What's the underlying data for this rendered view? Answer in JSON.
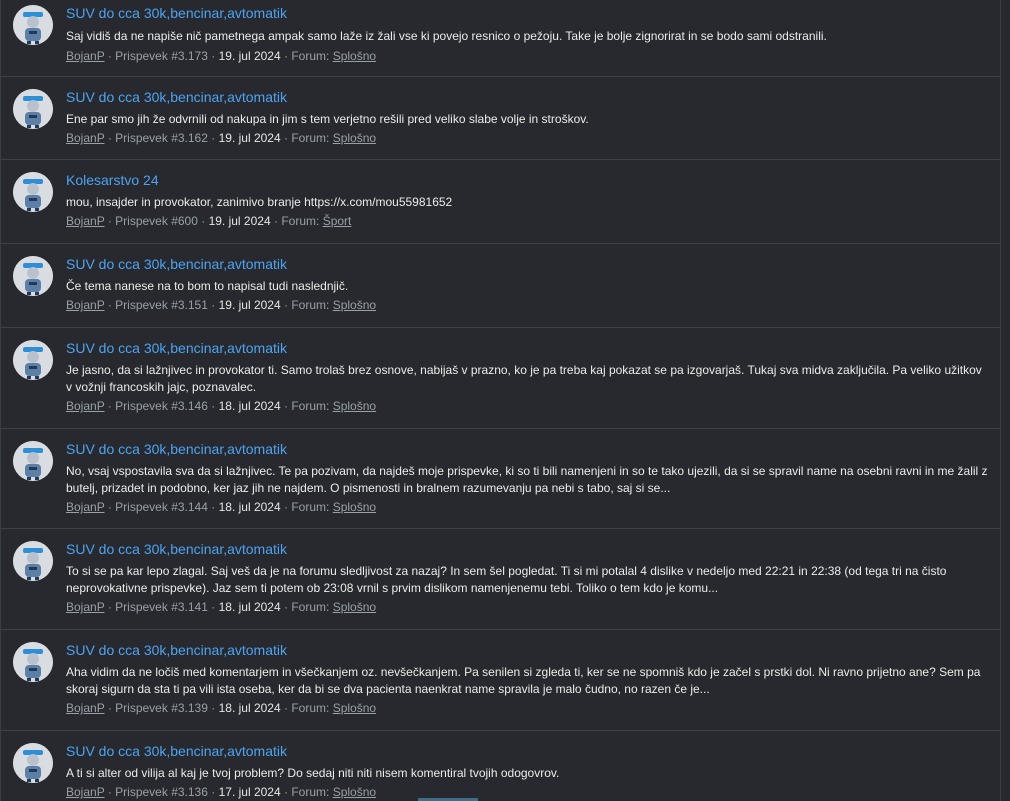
{
  "posts": [
    {
      "thread_title": "SUV do cca 30k,bencinar,avtomatik",
      "snippet": "Saj vidiš da ne napiše nič pametnega ampak samo laže iz žali vse ki povejo resnico o pežoju. Take je bolje zignorirat in se bodo sami odstranili.",
      "author": "BojanP",
      "sep1": "·",
      "post_number": "Prispevek #3.173",
      "sep2": "·",
      "date": "19. jul 2024",
      "sep3": "·",
      "forum_prefix": "Forum:",
      "forum": "Splošno"
    },
    {
      "thread_title": "SUV do cca 30k,bencinar,avtomatik",
      "snippet": "Ene par smo jih že odvrnili od nakupa in jim s tem verjetno rešili pred veliko slabe volje in stroškov.",
      "author": "BojanP",
      "sep1": "·",
      "post_number": "Prispevek #3.162",
      "sep2": "·",
      "date": "19. jul 2024",
      "sep3": "·",
      "forum_prefix": "Forum:",
      "forum": "Splošno"
    },
    {
      "thread_title": "Kolesarstvo 24",
      "snippet": "mou, insajder in provokator, zanimivo branje https://x.com/mou55981652",
      "author": "BojanP",
      "sep1": "·",
      "post_number": "Prispevek #600",
      "sep2": "·",
      "date": "19. jul 2024",
      "sep3": "·",
      "forum_prefix": "Forum:",
      "forum": "Šport"
    },
    {
      "thread_title": "SUV do cca 30k,bencinar,avtomatik",
      "snippet": "Če tema nanese na to bom to napisal tudi naslednjič.",
      "author": "BojanP",
      "sep1": "·",
      "post_number": "Prispevek #3.151",
      "sep2": "·",
      "date": "19. jul 2024",
      "sep3": "·",
      "forum_prefix": "Forum:",
      "forum": "Splošno"
    },
    {
      "thread_title": "SUV do cca 30k,bencinar,avtomatik",
      "snippet": "Je jasno, da si lažnjivec in provokator ti. Samo trolaš brez osnove, nabijaš v prazno, ko je pa treba kaj pokazat se pa izgovarjaš. Tukaj sva midva zaključila. Pa veliko užitkov v vožnji francoskih jajc, poznavalec.",
      "author": "BojanP",
      "sep1": "·",
      "post_number": "Prispevek #3.146",
      "sep2": "·",
      "date": "18. jul 2024",
      "sep3": "·",
      "forum_prefix": "Forum:",
      "forum": "Splošno"
    },
    {
      "thread_title": "SUV do cca 30k,bencinar,avtomatik",
      "snippet": "No, vsaj vspostavila sva da si lažnjivec. Te pa pozivam, da najdeš moje prispevke, ki so ti bili namenjeni in so te tako ujezili, da si se spravil name na osebni ravni in me žalil z butelj, prizadet in podobno, ker jaz jih ne najdem. O pismenosti in bralnem razumevanju pa nebi s tabo, saj si se...",
      "author": "BojanP",
      "sep1": "·",
      "post_number": "Prispevek #3.144",
      "sep2": "·",
      "date": "18. jul 2024",
      "sep3": "·",
      "forum_prefix": "Forum:",
      "forum": "Splošno"
    },
    {
      "thread_title": "SUV do cca 30k,bencinar,avtomatik",
      "snippet": "To si se pa kar lepo zlagal. Saj veš da je na forumu sledljivost za nazaj? In sem šel pogledat. Ti si mi potalal 4 dislike v nedeljo med 22:21 in 22:38 (od tega tri na čisto neprovokativne prispevke). Jaz sem ti potem ob 23:08 vrnil s prvim dislikom namenjenemu tebi. Toliko o tem kdo je komu...",
      "author": "BojanP",
      "sep1": "·",
      "post_number": "Prispevek #3.141",
      "sep2": "·",
      "date": "18. jul 2024",
      "sep3": "·",
      "forum_prefix": "Forum:",
      "forum": "Splošno"
    },
    {
      "thread_title": "SUV do cca 30k,bencinar,avtomatik",
      "snippet": "Aha vidim da ne ločiš med komentarjem in všečkanjem oz. nevšečkanjem. Pa senilen si zgleda ti, ker se ne spomniš kdo je začel s prstki dol. Ni ravno prijetno ane? Sem pa skoraj sigurn da sta ti pa vili ista oseba, ker da bi se dva pacienta naenkrat name spravila je malo čudno, no razen če je...",
      "author": "BojanP",
      "sep1": "·",
      "post_number": "Prispevek #3.139",
      "sep2": "·",
      "date": "18. jul 2024",
      "sep3": "·",
      "forum_prefix": "Forum:",
      "forum": "Splošno"
    },
    {
      "thread_title": "SUV do cca 30k,bencinar,avtomatik",
      "snippet": "A ti si alter od vilija al kaj je tvoj problem? Do sedaj niti niti nisem komentiral tvojih odogovrov.",
      "author": "BojanP",
      "sep1": "·",
      "post_number": "Prispevek #3.136",
      "sep2": "·",
      "date": "17. jul 2024",
      "sep3": "·",
      "forum_prefix": "Forum:",
      "forum": "Splošno"
    }
  ]
}
